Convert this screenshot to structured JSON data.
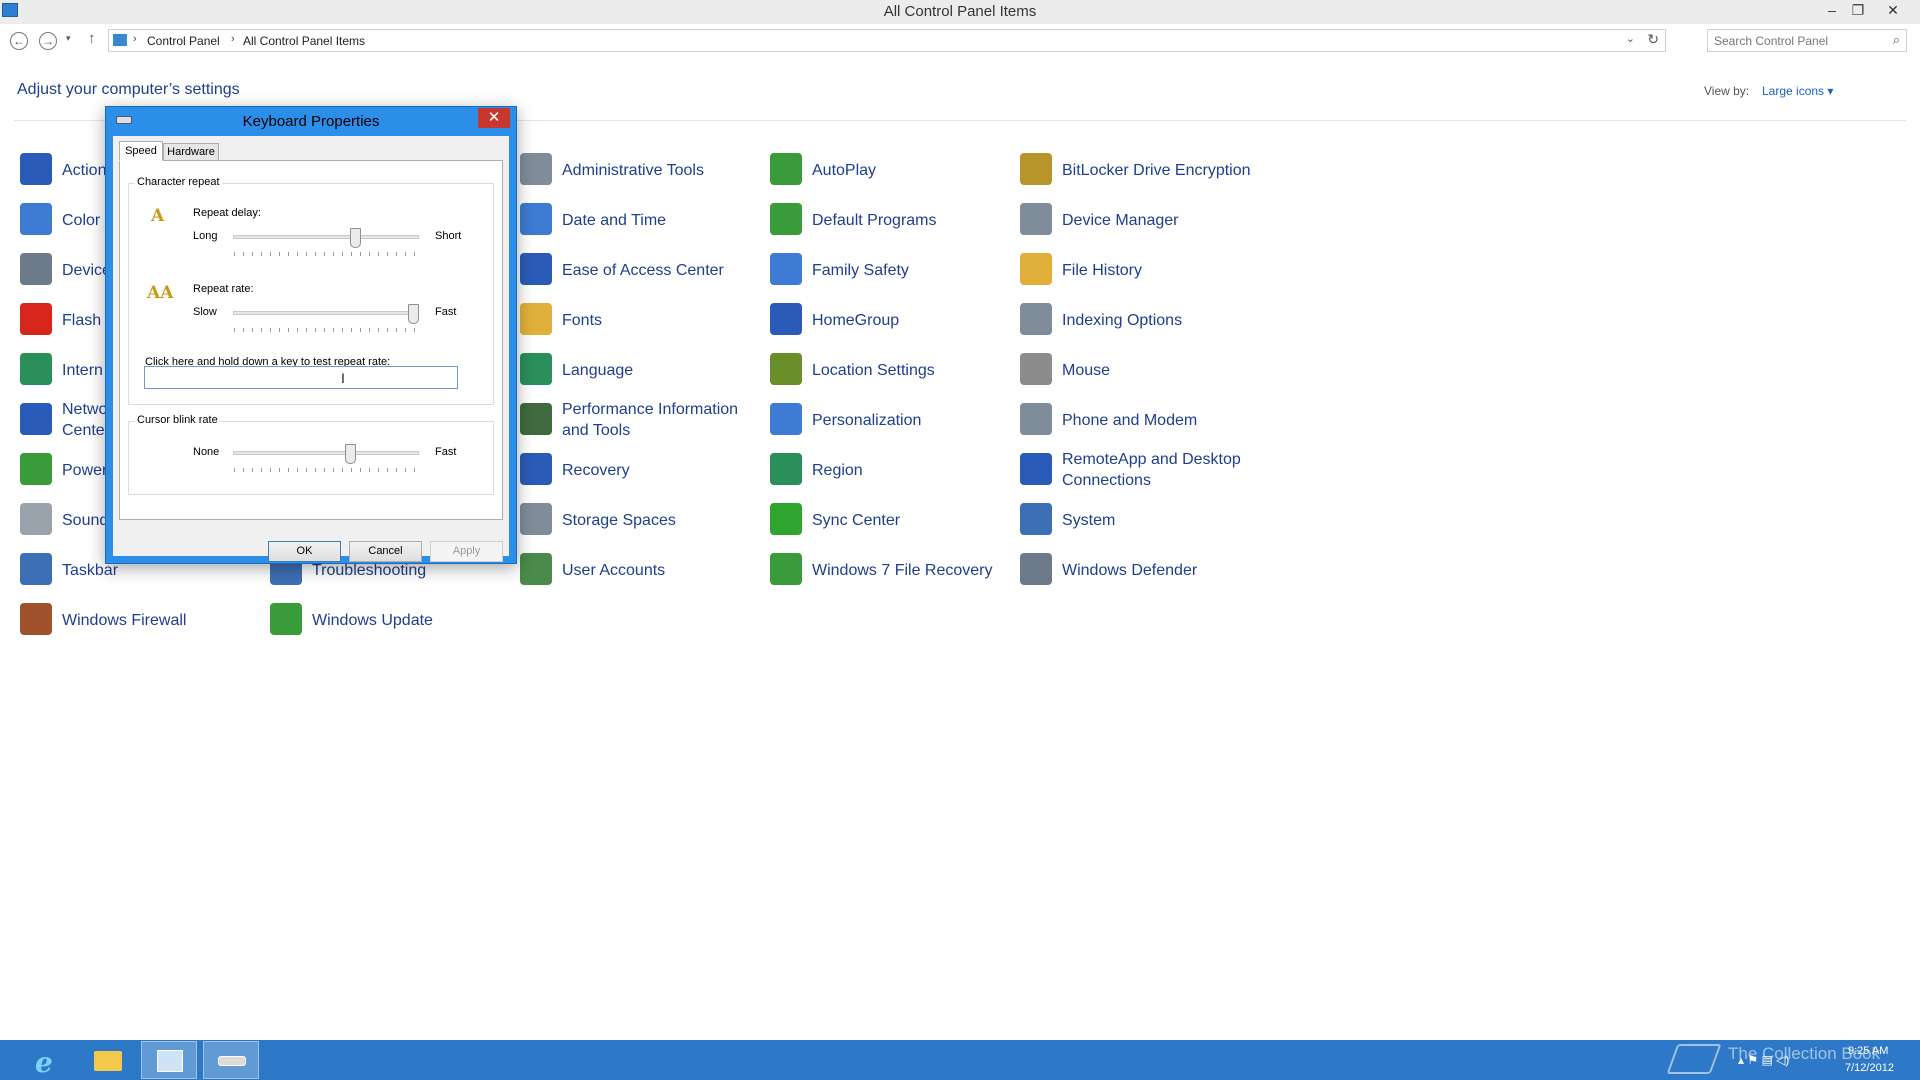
{
  "window": {
    "title": "All Control Panel Items",
    "minimize_glyph": "–",
    "restore_glyph": "❐",
    "close_glyph": "✕"
  },
  "nav": {
    "back_glyph": "←",
    "forward_glyph": "→",
    "recent_glyph": "▾",
    "up_glyph": "↑",
    "breadcrumbs": [
      "Control Panel",
      "All Control Panel Items"
    ],
    "crumb_sep": "›",
    "dropdown_glyph": "⌄",
    "refresh_glyph": "↻",
    "search_placeholder": "Search Control Panel",
    "search_glyph": "⌕"
  },
  "header": {
    "title": "Adjust your computer’s settings",
    "view_by_label": "View by:",
    "view_by_value": "Large icons ▾"
  },
  "items": [
    {
      "label": "Action",
      "icon": "flag-icon",
      "color": "#2a5bb8"
    },
    {
      "label": "Color",
      "icon": "color-management-icon",
      "color": "#3d7bd4"
    },
    {
      "label": "Device",
      "icon": "devices-printers-icon",
      "color": "#6c7a89"
    },
    {
      "label": "Flash",
      "icon": "flash-player-icon",
      "color": "#d9261c"
    },
    {
      "label": "Intern",
      "icon": "internet-options-icon",
      "color": "#2a8f5b"
    },
    {
      "label": "Netwo\nCente",
      "icon": "network-icon",
      "color": "#2a5bb8"
    },
    {
      "label": "Power",
      "icon": "power-options-icon",
      "color": "#3a9b3a"
    },
    {
      "label": "Sound",
      "icon": "sound-icon",
      "color": "#9aa3ab"
    },
    {
      "label": "Taskbar",
      "icon": "taskbar-icon",
      "color": "#3d6fb5"
    },
    {
      "label": "Windows Firewall",
      "icon": "firewall-icon",
      "color": "#a0522d"
    },
    {
      "label": "Troubleshooting",
      "icon": "troubleshooting-icon",
      "color": "#3d6fb5"
    },
    {
      "label": "Windows Update",
      "icon": "windows-update-icon",
      "color": "#3a9b3a"
    },
    {
      "label": "Administrative Tools",
      "icon": "admin-tools-icon",
      "color": "#7f8c99"
    },
    {
      "label": "Date and Time",
      "icon": "date-time-icon",
      "color": "#3d7bd4"
    },
    {
      "label": "Ease of Access Center",
      "icon": "ease-of-access-icon",
      "color": "#2a5bb8"
    },
    {
      "label": "Fonts",
      "icon": "fonts-icon",
      "color": "#e0b03a"
    },
    {
      "label": "Language",
      "icon": "language-icon",
      "color": "#2a8f5b"
    },
    {
      "label": "Performance Information\nand Tools",
      "icon": "performance-icon",
      "color": "#3f6b3f"
    },
    {
      "label": "Recovery",
      "icon": "recovery-icon",
      "color": "#2a5bb8"
    },
    {
      "label": "Storage Spaces",
      "icon": "storage-spaces-icon",
      "color": "#7f8c99"
    },
    {
      "label": "User Accounts",
      "icon": "user-accounts-icon",
      "color": "#4a8a4a"
    },
    {
      "label": "AutoPlay",
      "icon": "autoplay-icon",
      "color": "#3a9b3a"
    },
    {
      "label": "Default Programs",
      "icon": "default-programs-icon",
      "color": "#3a9b3a"
    },
    {
      "label": "Family Safety",
      "icon": "family-safety-icon",
      "color": "#3d7bd4"
    },
    {
      "label": "HomeGroup",
      "icon": "homegroup-icon",
      "color": "#2a5bb8"
    },
    {
      "label": "Location Settings",
      "icon": "location-settings-icon",
      "color": "#6a8f2a"
    },
    {
      "label": "Personalization",
      "icon": "personalization-icon",
      "color": "#3d7bd4"
    },
    {
      "label": "Region",
      "icon": "region-icon",
      "color": "#2a8f5b"
    },
    {
      "label": "Sync Center",
      "icon": "sync-center-icon",
      "color": "#2fa52f"
    },
    {
      "label": "Windows 7 File Recovery",
      "icon": "file-recovery-icon",
      "color": "#3a9b3a"
    },
    {
      "label": "BitLocker Drive Encryption",
      "icon": "bitlocker-icon",
      "color": "#b8952a"
    },
    {
      "label": "Device Manager",
      "icon": "device-manager-icon",
      "color": "#7f8c99"
    },
    {
      "label": "File History",
      "icon": "file-history-icon",
      "color": "#e0b03a"
    },
    {
      "label": "Indexing Options",
      "icon": "indexing-options-icon",
      "color": "#7f8c99"
    },
    {
      "label": "Mouse",
      "icon": "mouse-icon",
      "color": "#8c8c8c"
    },
    {
      "label": "Phone and Modem",
      "icon": "phone-modem-icon",
      "color": "#7f8c99"
    },
    {
      "label": "RemoteApp and Desktop\nConnections",
      "icon": "remoteapp-icon",
      "color": "#2a5bb8"
    },
    {
      "label": "System",
      "icon": "system-icon",
      "color": "#3d6fb5"
    },
    {
      "label": "Windows Defender",
      "icon": "windows-defender-icon",
      "color": "#6c7a89"
    }
  ],
  "dialog": {
    "title": "Keyboard Properties",
    "close_glyph": "✕",
    "tabs": [
      "Speed",
      "Hardware"
    ],
    "character_repeat": {
      "title": "Character repeat",
      "repeat_delay_label": "Repeat delay:",
      "delay_min": "Long",
      "delay_max": "Short",
      "delay_level": 0.67,
      "repeat_rate_label": "Repeat rate:",
      "rate_min": "Slow",
      "rate_max": "Fast",
      "rate_level": 1.0,
      "delay_glyph": "A",
      "rate_glyph": "AA",
      "test_label": "Click here and hold down a key to test repeat rate:",
      "test_value": "",
      "cursor_glyph": "I"
    },
    "cursor_blink": {
      "title": "Cursor blink rate",
      "min": "None",
      "max": "Fast",
      "level": 0.64
    },
    "buttons": {
      "ok": "OK",
      "cancel": "Cancel",
      "apply": "Apply"
    }
  },
  "taskbar": {
    "ie_glyph": "e",
    "watermark": "The Collection Book",
    "time": "9:25 AM",
    "date": "7/12/2012",
    "tray_glyphs": "▴ ⚑ ▤ ◁)"
  }
}
